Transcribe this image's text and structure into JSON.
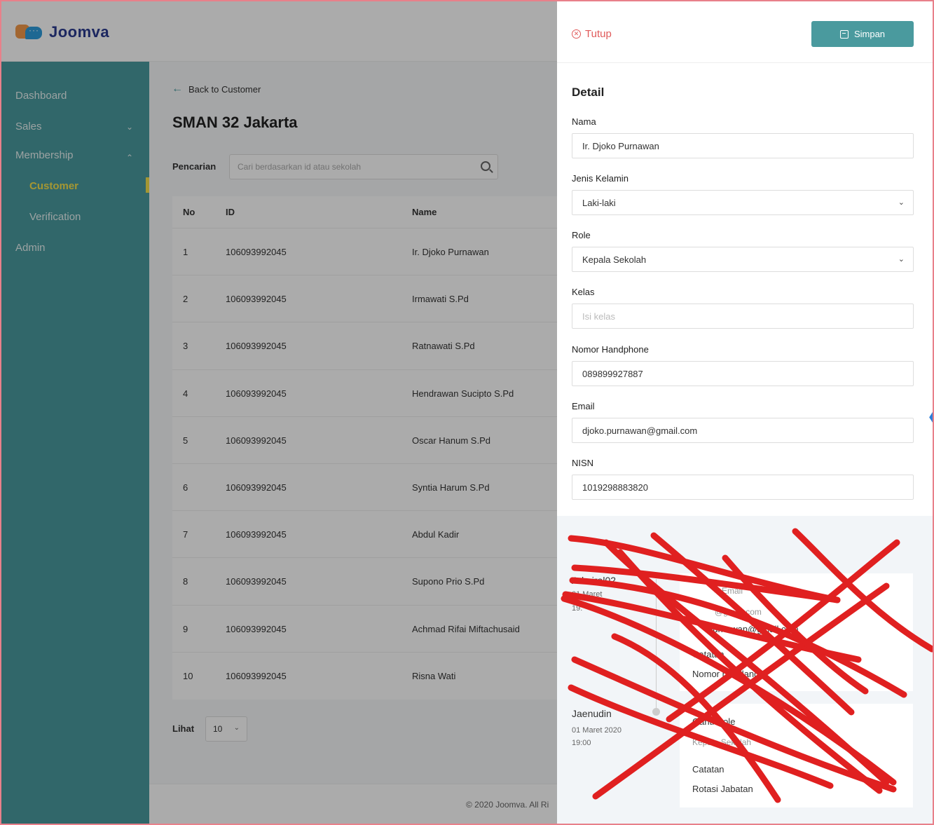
{
  "brand": {
    "name": "Joomva"
  },
  "sidebar": {
    "items": [
      {
        "label": "Dashboard"
      },
      {
        "label": "Sales"
      },
      {
        "label": "Membership"
      },
      {
        "label": "Customer"
      },
      {
        "label": "Verification"
      },
      {
        "label": "Admin"
      }
    ]
  },
  "main": {
    "back_label": "Back to Customer",
    "title": "SMAN 32 Jakarta",
    "search": {
      "label": "Pencarian",
      "placeholder": "Cari berdasarkan id atau sekolah"
    },
    "table": {
      "headers": [
        "No",
        "ID",
        "Name"
      ],
      "rows": [
        [
          "1",
          "106093992045",
          "Ir. Djoko Purnawan"
        ],
        [
          "2",
          "106093992045",
          "Irmawati S.Pd"
        ],
        [
          "3",
          "106093992045",
          "Ratnawati S.Pd"
        ],
        [
          "4",
          "106093992045",
          "Hendrawan Sucipto S.Pd"
        ],
        [
          "5",
          "106093992045",
          "Oscar Hanum S.Pd"
        ],
        [
          "6",
          "106093992045",
          "Syntia Harum S.Pd"
        ],
        [
          "7",
          "106093992045",
          "Abdul Kadir"
        ],
        [
          "8",
          "106093992045",
          "Supono Prio S.Pd"
        ],
        [
          "9",
          "106093992045",
          "Achmad Rifai Miftachusaid"
        ],
        [
          "10",
          "106093992045",
          "Risna Wati"
        ]
      ]
    },
    "page_size": {
      "label": "Lihat",
      "value": "10"
    }
  },
  "footer": {
    "text": "© 2020 Joomva. All Ri"
  },
  "drawer": {
    "close_label": "Tutup",
    "save_label": "Simpan",
    "section_title": "Detail",
    "fields": [
      {
        "label": "Nama",
        "value": "Ir. Djoko Purnawan",
        "placeholder": ""
      },
      {
        "label": "Jenis Kelamin",
        "value": "Laki-laki",
        "placeholder": ""
      },
      {
        "label": "Role",
        "value": "Kepala Sekolah",
        "placeholder": ""
      },
      {
        "label": "Kelas",
        "value": "",
        "placeholder": "Isi kelas"
      },
      {
        "label": "Nomor Handphone",
        "value": "089899927887",
        "placeholder": ""
      },
      {
        "label": "Email",
        "value": "djoko.purnawan@gmail.com",
        "placeholder": ""
      },
      {
        "label": "NISN",
        "value": "1019298883820",
        "placeholder": ""
      }
    ],
    "history": {
      "entries": [
        {
          "user": "Admiral02",
          "date": "01 Maret",
          "time": "19:",
          "lines": [
            "Email",
            "@gmail.com",
            "purnawan@gmail.com",
            "Catatan",
            "Nomor hp hilang"
          ]
        },
        {
          "user": "Jaenudin",
          "date": "01 Maret 2020",
          "time": "19:00",
          "lines": [
            "Ganti Role",
            "Kepala Sekolah",
            "Catatan",
            "Rotasi Jabatan"
          ]
        }
      ]
    }
  }
}
